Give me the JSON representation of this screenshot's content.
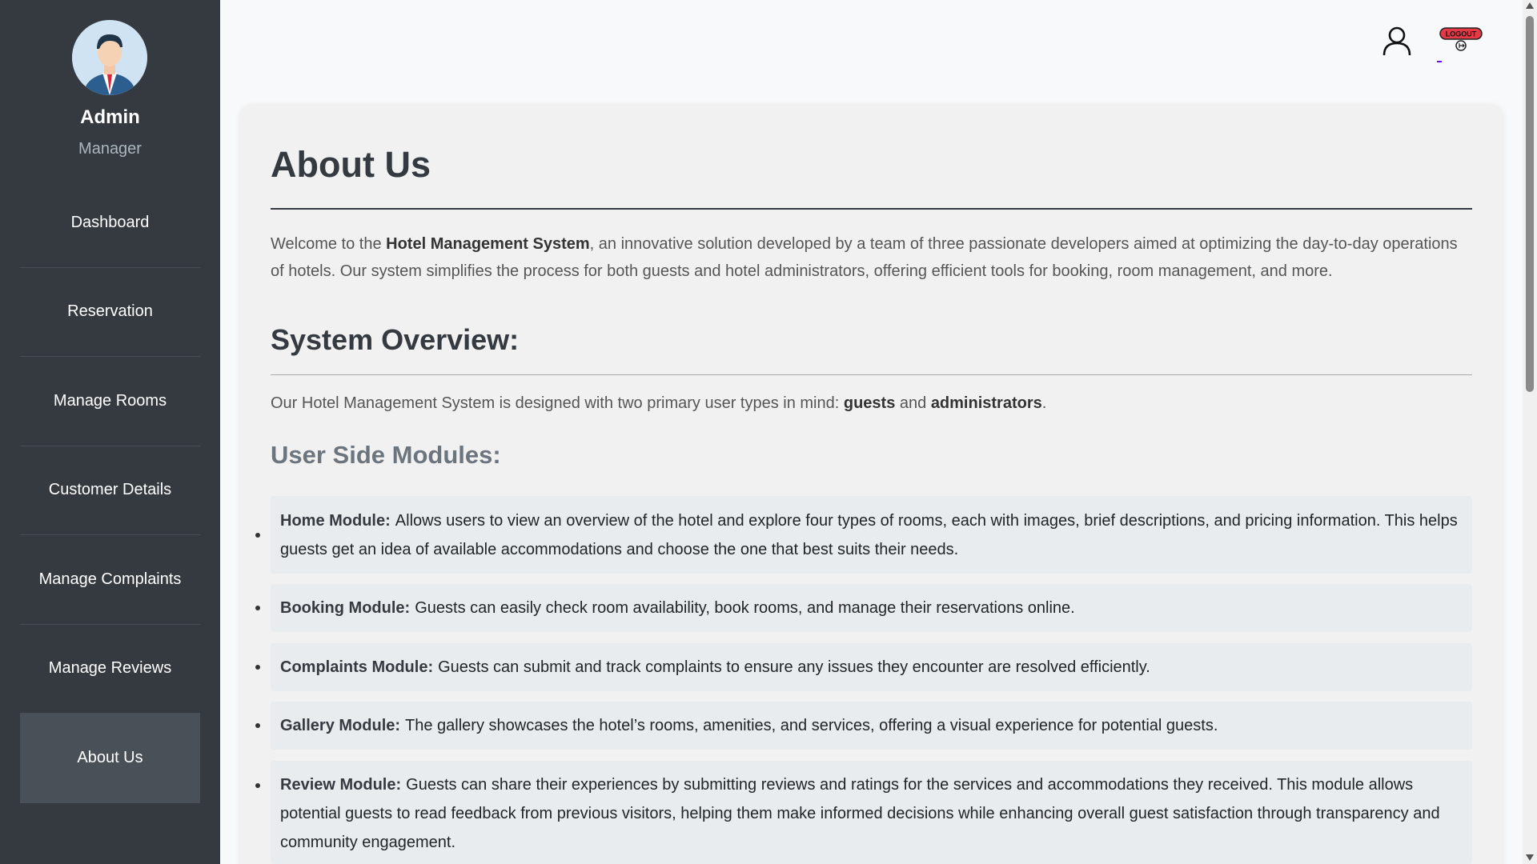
{
  "sidebar": {
    "name": "Admin",
    "role": "Manager",
    "items": [
      {
        "label": "Dashboard"
      },
      {
        "label": "Reservation"
      },
      {
        "label": "Manage Rooms"
      },
      {
        "label": "Customer Details"
      },
      {
        "label": "Manage Complaints"
      },
      {
        "label": "Manage Reviews"
      },
      {
        "label": "About Us",
        "active": true
      }
    ]
  },
  "header": {
    "logout_label": "LOGOUT"
  },
  "main": {
    "title": "About Us",
    "intro": {
      "before": "Welcome to the ",
      "bold": "Hotel Management System",
      "after": ", an innovative solution developed by a team of three passionate developers aimed at optimizing the day-to-day operations of hotels. Our system simplifies the process for both guests and hotel administrators, offering efficient tools for booking, room management, and more."
    },
    "overview_title": "System Overview:",
    "overview": {
      "before": "Our Hotel Management System is designed with two primary user types in mind: ",
      "bold1": "guests",
      "middle": " and ",
      "bold2": "administrators",
      "after": "."
    },
    "user_modules_title": "User Side Modules:",
    "modules": [
      {
        "name": "Home Module:",
        "text": "Allows users to view an overview of the hotel and explore four types of rooms, each with images, brief descriptions, and pricing information. This helps guests get an idea of available accommodations and choose the one that best suits their needs."
      },
      {
        "name": "Booking Module:",
        "text": "Guests can easily check room availability, book rooms, and manage their reservations online."
      },
      {
        "name": "Complaints Module:",
        "text": "Guests can submit and track complaints to ensure any issues they encounter are resolved efficiently."
      },
      {
        "name": "Gallery Module:",
        "text": "The gallery showcases the hotel’s rooms, amenities, and services, offering a visual experience for potential guests."
      },
      {
        "name": "Review Module:",
        "text": "Guests can share their experiences by submitting reviews and ratings for the services and accommodations they received. This module allows potential guests to read feedback from previous visitors, helping them make informed decisions while enhancing overall guest satisfaction through transparency and community engagement."
      }
    ]
  },
  "colors": {
    "sidebar_bg": "#343a40",
    "active_item_bg": "#495057",
    "logout_red": "#e63946"
  }
}
